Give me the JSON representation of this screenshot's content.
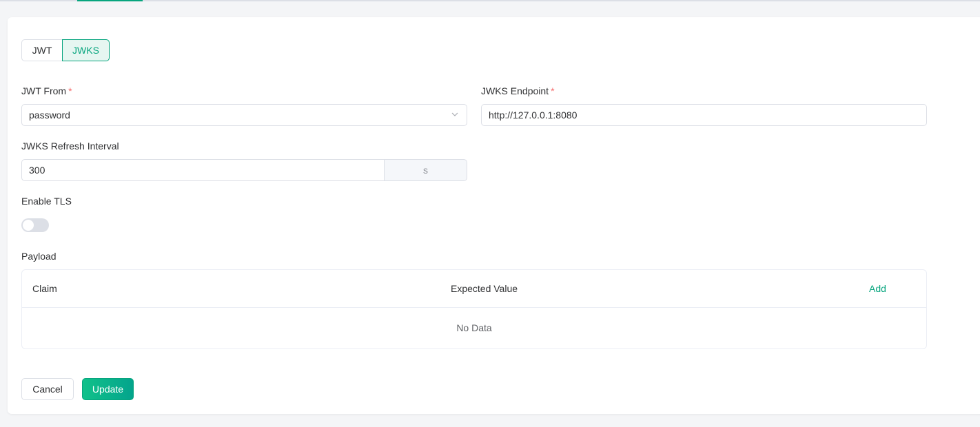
{
  "mode_switch": {
    "options": [
      "JWT",
      "JWKS"
    ],
    "selected": "JWKS"
  },
  "form": {
    "jwt_from": {
      "label": "JWT From",
      "required_mark": "*",
      "value": "password"
    },
    "jwks_endpoint": {
      "label": "JWKS Endpoint",
      "required_mark": "*",
      "value": "http://127.0.0.1:8080"
    },
    "jwks_refresh_interval": {
      "label": "JWKS Refresh Interval",
      "value": "300",
      "unit": "s"
    },
    "enable_tls": {
      "label": "Enable TLS",
      "enabled": false
    },
    "payload": {
      "label": "Payload",
      "columns": [
        "Claim",
        "Expected Value"
      ],
      "add_label": "Add",
      "rows": [],
      "empty_text": "No Data"
    }
  },
  "actions": {
    "cancel_label": "Cancel",
    "update_label": "Update"
  },
  "colors": {
    "accent": "#07a57e",
    "required": "#f56c6c",
    "border": "#dcdfe6"
  }
}
